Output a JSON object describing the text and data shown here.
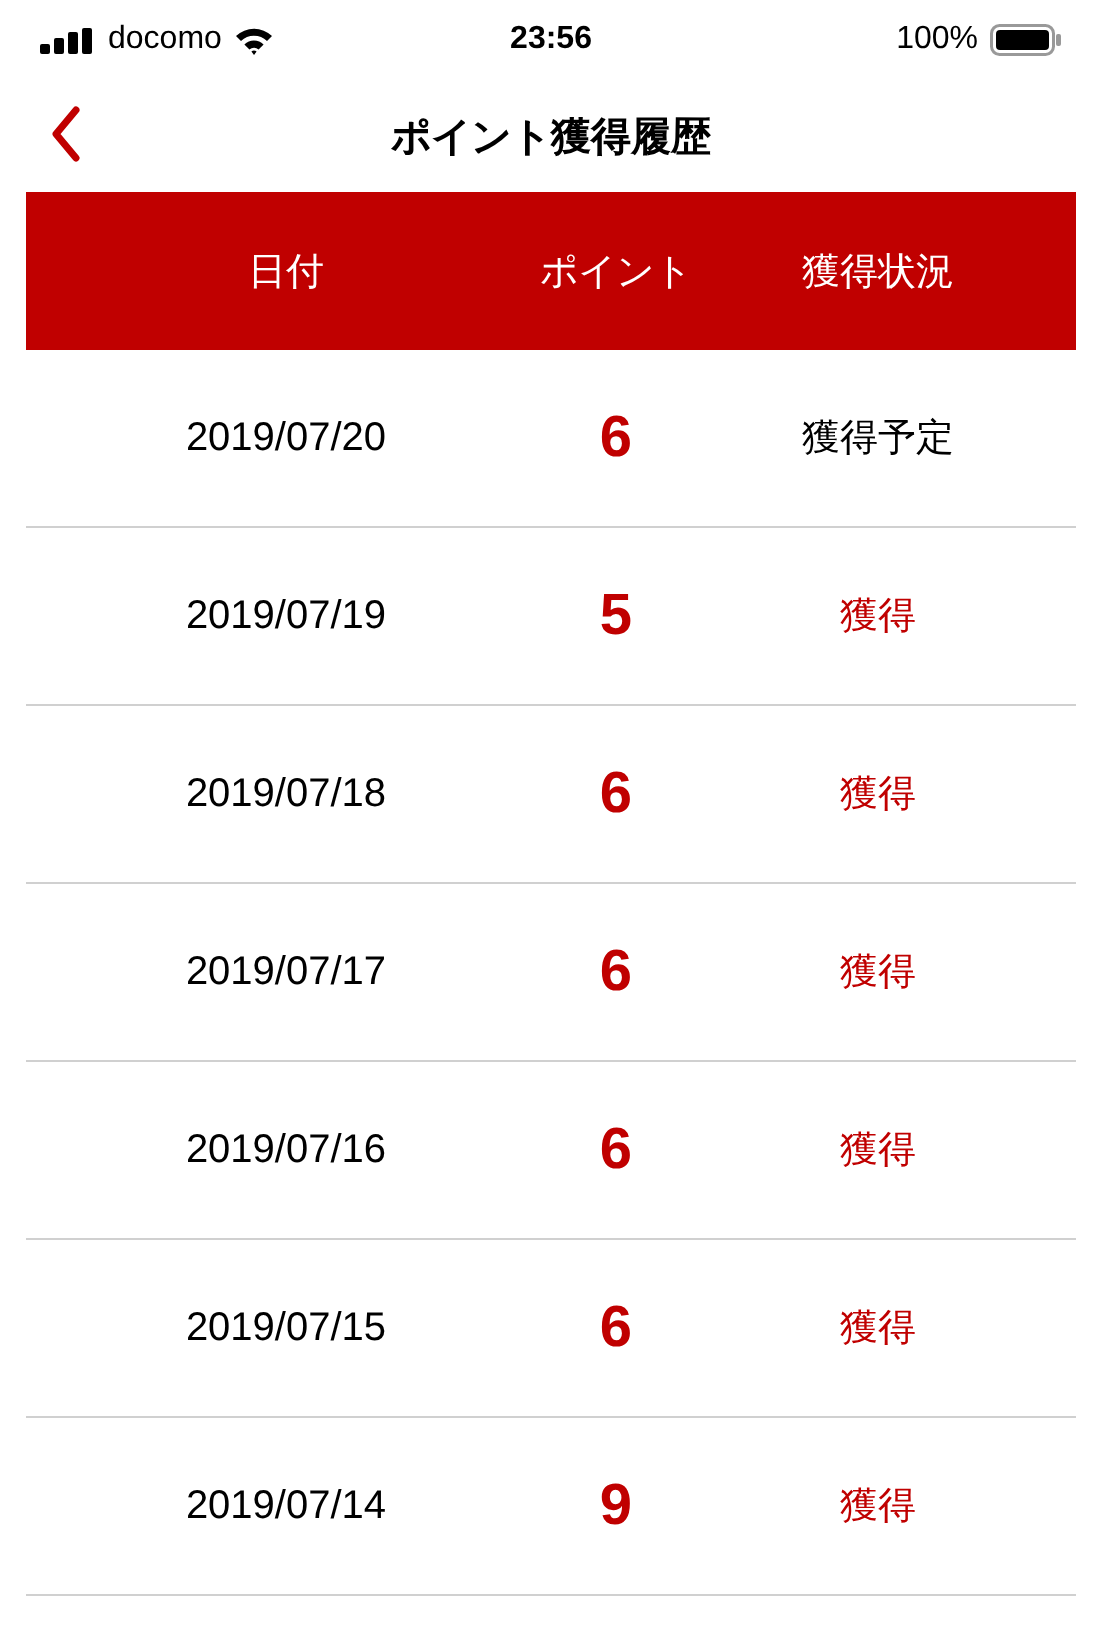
{
  "status_bar": {
    "carrier": "docomo",
    "time": "23:56",
    "battery": "100%"
  },
  "nav": {
    "title": "ポイント獲得履歴"
  },
  "table": {
    "columns": [
      "日付",
      "ポイント",
      "獲得状況"
    ],
    "rows": [
      {
        "date": "2019/07/20",
        "points": "6",
        "status": "獲得予定",
        "kind": "pending"
      },
      {
        "date": "2019/07/19",
        "points": "5",
        "status": "獲得",
        "kind": "earned"
      },
      {
        "date": "2019/07/18",
        "points": "6",
        "status": "獲得",
        "kind": "earned"
      },
      {
        "date": "2019/07/17",
        "points": "6",
        "status": "獲得",
        "kind": "earned"
      },
      {
        "date": "2019/07/16",
        "points": "6",
        "status": "獲得",
        "kind": "earned"
      },
      {
        "date": "2019/07/15",
        "points": "6",
        "status": "獲得",
        "kind": "earned"
      },
      {
        "date": "2019/07/14",
        "points": "9",
        "status": "獲得",
        "kind": "earned"
      }
    ]
  }
}
